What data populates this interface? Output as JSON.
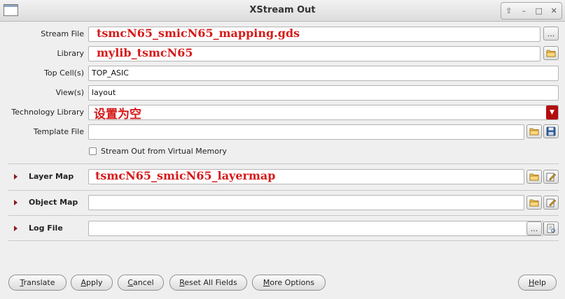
{
  "window": {
    "title": "XStream Out",
    "controls": [
      "⇧",
      "–",
      "□",
      "✕"
    ]
  },
  "form": {
    "stream_file": {
      "label": "Stream File",
      "value": "",
      "annotation": "tsmcN65_smicN65_mapping.gds",
      "browse": "..."
    },
    "library": {
      "label": "Library",
      "value": "",
      "annotation": "mylib_tsmcN65"
    },
    "top_cell": {
      "label": "Top Cell(s)",
      "value": "TOP_ASIC"
    },
    "views": {
      "label": "View(s)",
      "value": "layout"
    },
    "technology_library": {
      "label": "Technology Library",
      "value": "",
      "annotation": "设置为空",
      "dropdown": "▼"
    },
    "template_file": {
      "label": "Template File",
      "value": ""
    },
    "virtual_memory": {
      "label": "Stream Out from Virtual Memory",
      "checked": false
    }
  },
  "sections": {
    "layer_map": {
      "label": "Layer Map",
      "value": "",
      "annotation": "tsmcN65_smicN65_layermap"
    },
    "object_map": {
      "label": "Object Map",
      "value": ""
    },
    "log_file": {
      "label": "Log File",
      "value": "",
      "browse": "..."
    }
  },
  "buttons": {
    "translate": {
      "mnemonic": "T",
      "rest": "ranslate"
    },
    "apply": {
      "mnemonic": "A",
      "rest": "pply"
    },
    "cancel": {
      "mnemonic": "C",
      "rest": "ancel"
    },
    "reset": {
      "mnemonic": "R",
      "rest": "eset All Fields"
    },
    "more": {
      "mnemonic": "M",
      "rest": "ore Options"
    },
    "help": {
      "mnemonic": "H",
      "rest": "elp"
    }
  },
  "colors": {
    "annotation": "#d61a1a",
    "accent": "#b30e0e",
    "section_arrow": "#8b1c1c"
  }
}
